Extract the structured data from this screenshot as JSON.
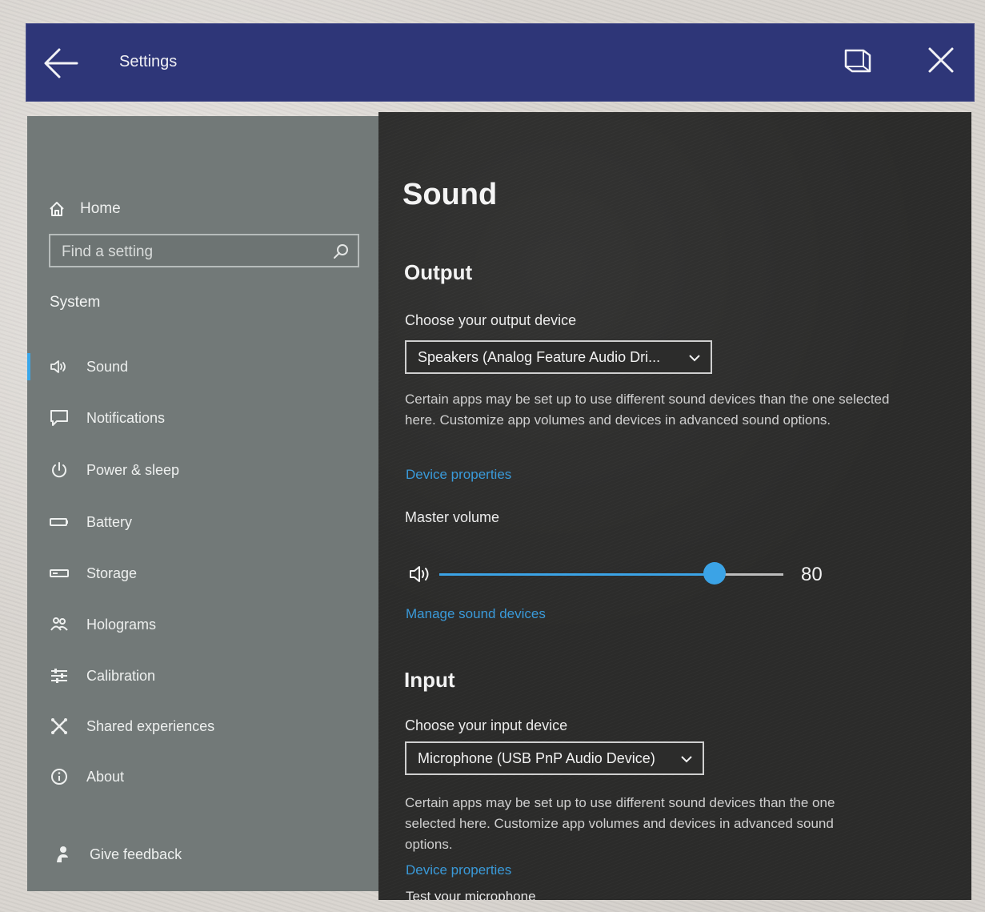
{
  "window": {
    "title": "Settings"
  },
  "sidebar": {
    "home_label": "Home",
    "search_placeholder": "Find a setting",
    "section": "System",
    "items": [
      {
        "label": "Sound",
        "icon": "speaker-icon",
        "active": true
      },
      {
        "label": "Notifications",
        "icon": "message-icon"
      },
      {
        "label": "Power & sleep",
        "icon": "power-icon"
      },
      {
        "label": "Battery",
        "icon": "battery-icon"
      },
      {
        "label": "Storage",
        "icon": "storage-icon"
      },
      {
        "label": "Holograms",
        "icon": "holograms-icon"
      },
      {
        "label": "Calibration",
        "icon": "calibration-icon"
      },
      {
        "label": "Shared experiences",
        "icon": "shared-icon"
      },
      {
        "label": "About",
        "icon": "info-icon"
      }
    ],
    "feedback_label": "Give feedback"
  },
  "content": {
    "page_title": "Sound",
    "output": {
      "heading": "Output",
      "device_label": "Choose your output device",
      "device_value": "Speakers (Analog Feature Audio Dri...",
      "description": "Certain apps may be set up to use different sound devices than the one selected here. Customize app volumes and devices in advanced sound options.",
      "device_properties_link": "Device properties",
      "master_volume_label": "Master volume",
      "volume_value": "80",
      "volume_level": 80,
      "manage_link": "Manage sound devices"
    },
    "input": {
      "heading": "Input",
      "device_label": "Choose your input device",
      "device_value": "Microphone (USB PnP Audio Device)",
      "description": "Certain apps may be set up to use different sound devices than the one selected here. Customize app volumes and devices in advanced sound options.",
      "device_properties_link": "Device properties",
      "test_label": "Test your microphone"
    }
  },
  "colors": {
    "title_bar": "#2e3678",
    "sidebar_bg": "#727978",
    "content_bg": "#2b2b2a",
    "accent": "#3ba3e6"
  }
}
